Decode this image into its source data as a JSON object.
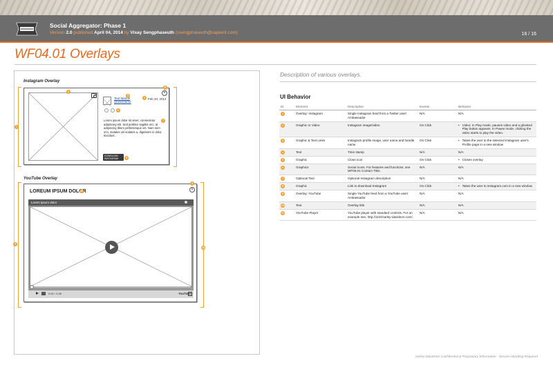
{
  "header": {
    "logo_text": "MOTOR HARLEY-DAVIDSON CYCLES",
    "title": "Social Aggregator: Phase 1",
    "version_prefix": "Version",
    "version": "2.0",
    "published_prefix": "published",
    "date": "April 04, 2014",
    "by_prefix": "by",
    "author": "Vixay Sengphaseuth",
    "email": "(vsengphaseuth@sapient.com)",
    "page": "16 / 16"
  },
  "page_title": "WF04.01 Overlays",
  "left_panel": {
    "instagram": {
      "label": "Instagram Overlay",
      "username": "Text Marion",
      "handle": "@username",
      "date": "Feb 20, 2014",
      "body": "Lorem ipsum dolor sit amet, consectetur adipiscing elit. Sed porttitor sagittis orci, at adipiscing libero pellentesque vel. Nam sem orci, sodales vel sodales a, dignissim in dolor tincidunt.",
      "button": "DOWNLOAD INSTAGRAM",
      "close": "×"
    },
    "youtube": {
      "label": "YouTube Overlay",
      "title": "LOREUM IPSUM DOLOR",
      "player_title": "Lorem ipsum dolor",
      "time": "0:00 / 3:35",
      "logo": "YouTube",
      "close": "×"
    }
  },
  "right": {
    "description": "Description of various overlays.",
    "section_title": "UI Behavior",
    "columns": [
      "ID",
      "Element",
      "Description",
      "Events",
      "Behavior"
    ],
    "rows": [
      {
        "id": "1",
        "element": "Overlay: Instagram",
        "description": "Single Instagram feed from a Twitter user/ Ambassador",
        "event": "N/A",
        "behavior": "N/A"
      },
      {
        "id": "2",
        "element": "Graphic or Video",
        "description": "Instagram image/video",
        "event": "On Click",
        "behavior": "Video: In Play mode, pauses video and a ghosted Play button appears. In Pause mode, clicking the video starts to play the video.",
        "bullet": true
      },
      {
        "id": "3",
        "element": "Graphic & Text Links",
        "description": "Instagram profile image, user name and handle name",
        "event": "On Click",
        "behavior": "Takes the user to the selected Instagram user's Profile page in a new window",
        "bullet": true
      },
      {
        "id": "4",
        "element": "Text",
        "description": "Time stamp",
        "event": "N/A",
        "behavior": "N/A"
      },
      {
        "id": "5",
        "element": "Graphic",
        "description": "Close icon",
        "event": "On Click",
        "behavior": "Closes overlay",
        "bullet": true
      },
      {
        "id": "6",
        "element": "Graphics",
        "description": "Social icons. For features and functions, see WF05.01 Contact Tiles.",
        "event": "N/A",
        "behavior": "N/A"
      },
      {
        "id": "7",
        "element": "Optional Text",
        "description": "Optional Instagram description",
        "event": "N/A",
        "behavior": "N/A"
      },
      {
        "id": "8",
        "element": "Graphic",
        "description": "Link to download Instagram",
        "event": "On Click",
        "behavior": "Takes the user to instagram.com in a new window",
        "bullet": true
      },
      {
        "id": "9",
        "element": "Overlay: YouTube",
        "description": "Single YouTube feed from a YouTube user/ Ambassador",
        "event": "N/A",
        "behavior": "N/A"
      },
      {
        "id": "10",
        "element": "Text",
        "description": "Overlay title",
        "event": "N/A",
        "behavior": "N/A"
      },
      {
        "id": "11",
        "element": "YouTube Player",
        "description": "YouTube player with standard controls. For an example see, http://1101harley-davidson.com/.",
        "event": "N/A",
        "behavior": "N/A"
      }
    ]
  },
  "footer": "Harley-Davidson Confidential & Proprietary Information - Secure Handling Required",
  "colors": {
    "accent": "#e46b1f",
    "marker": "#f0a030",
    "header_bg": "#6d6d6d"
  }
}
